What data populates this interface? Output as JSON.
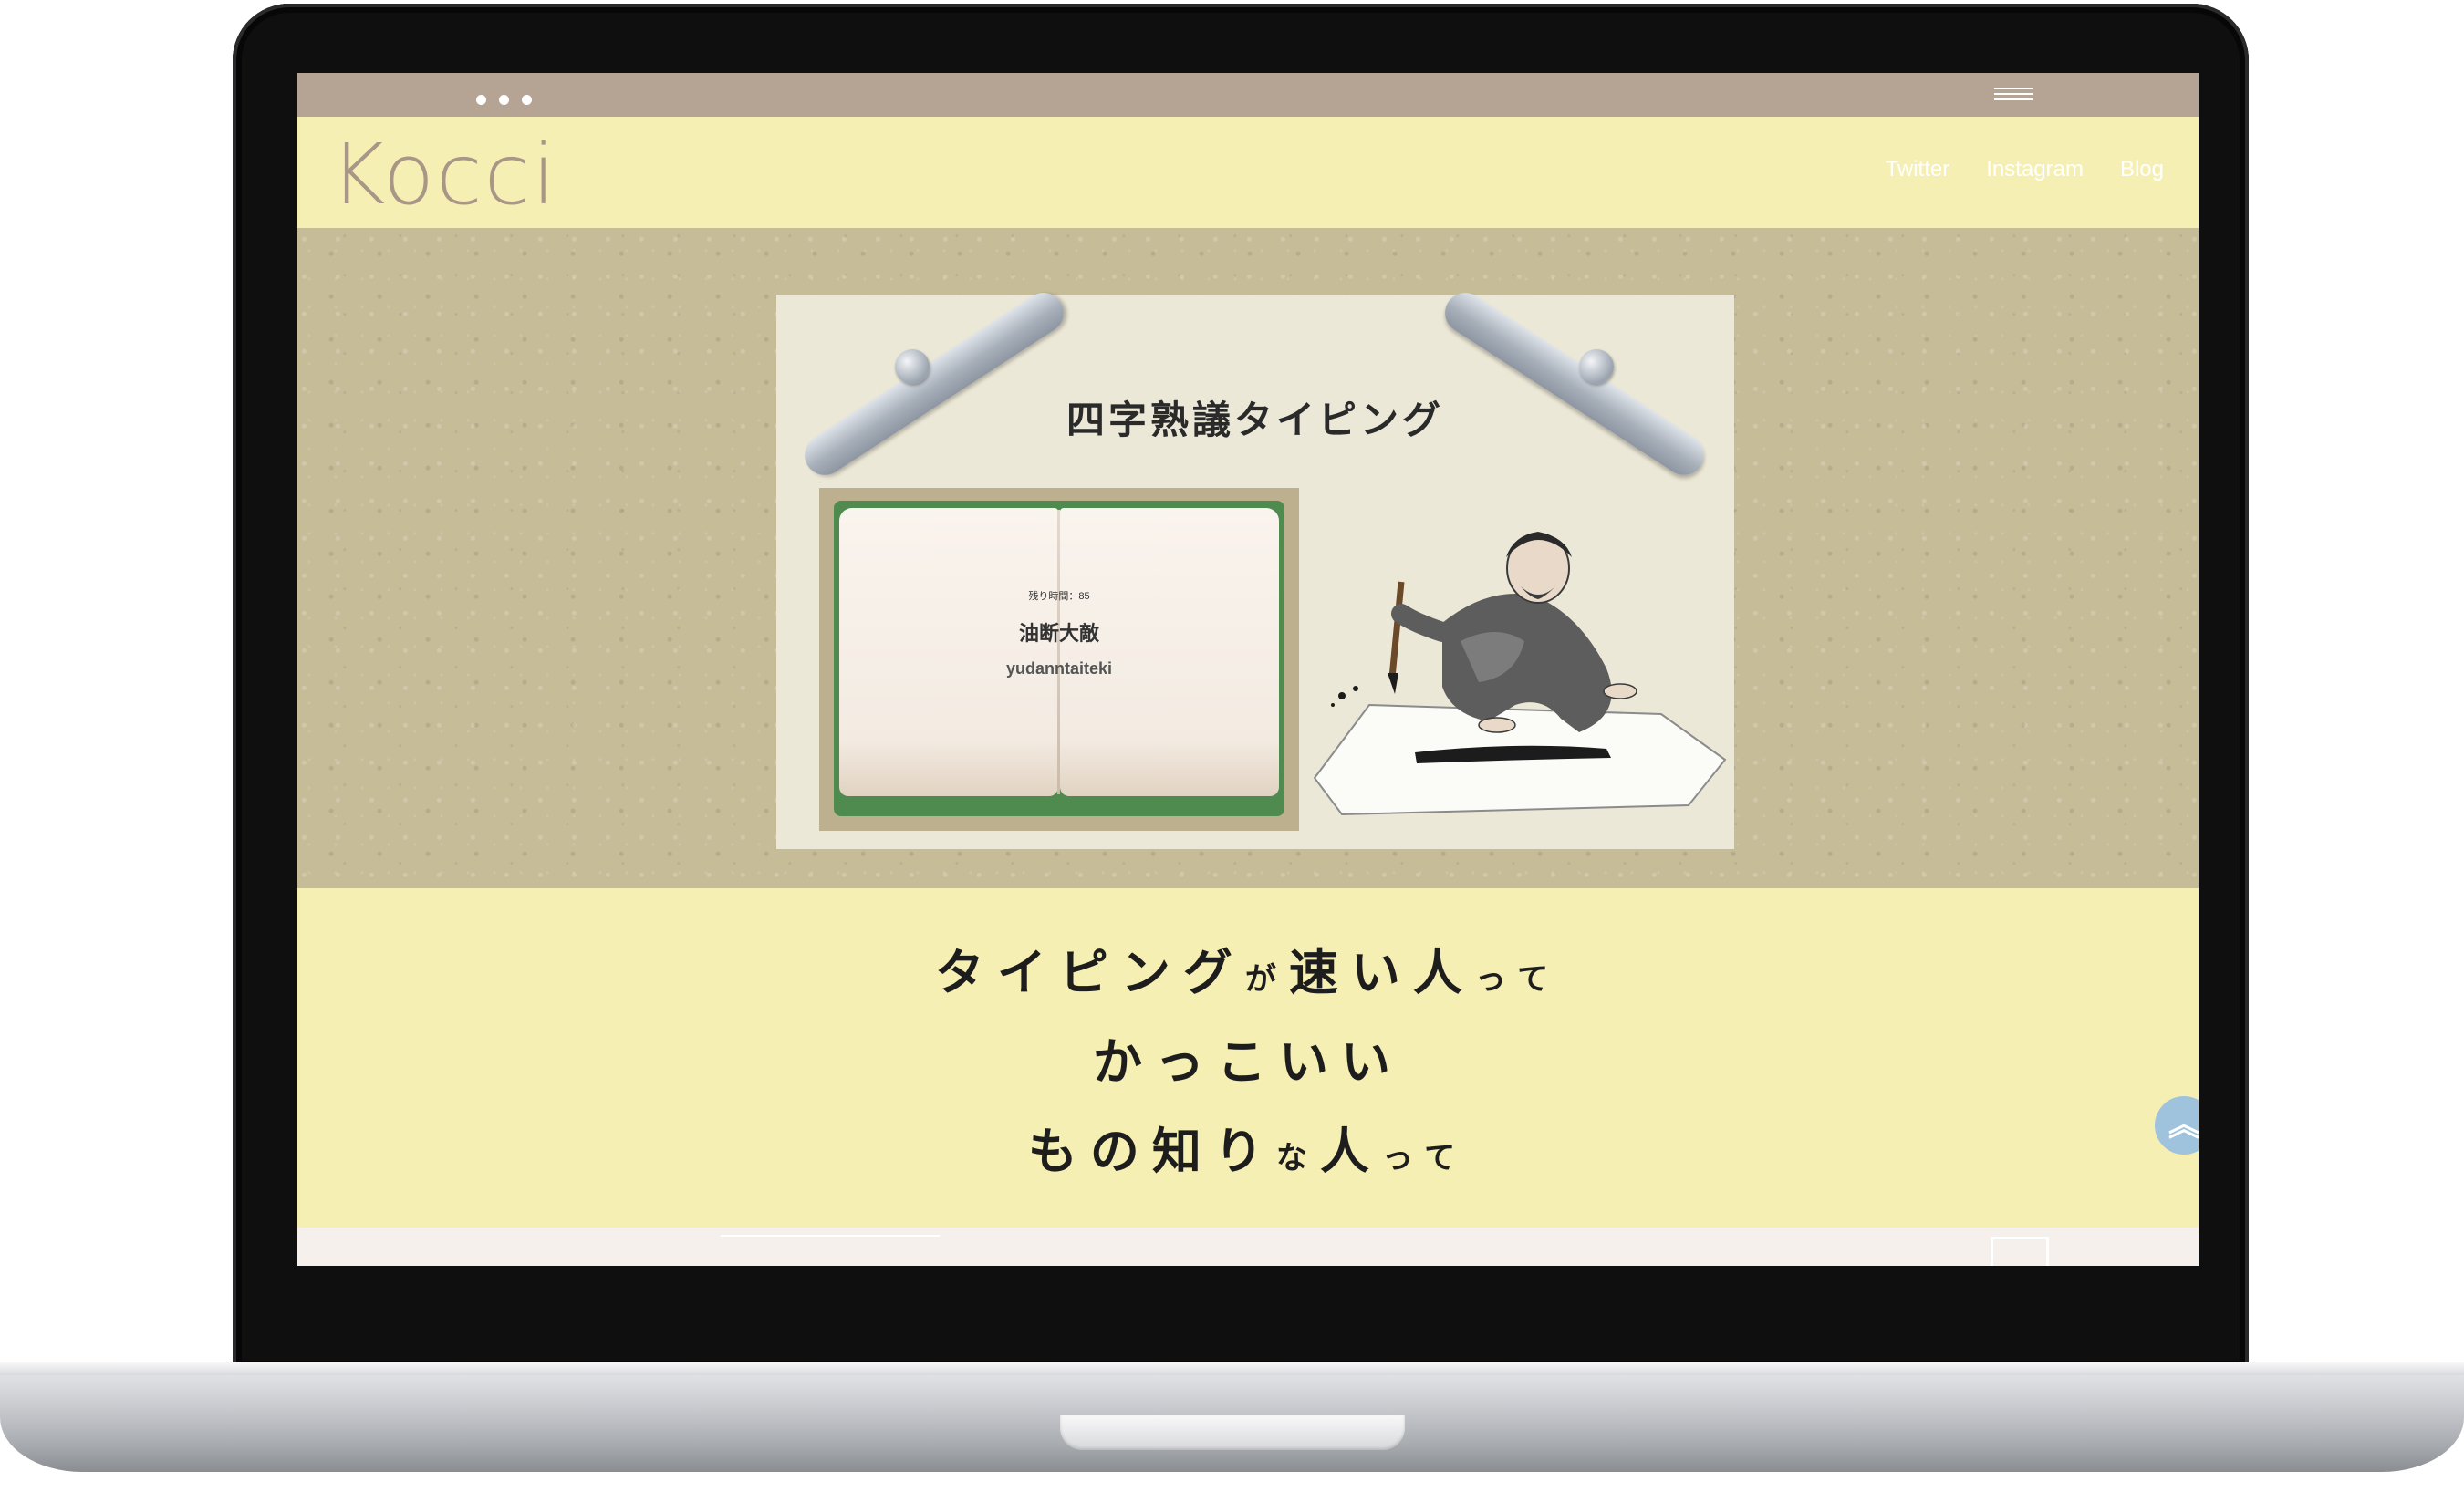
{
  "browser": {
    "menu_icon": "hamburger-icon"
  },
  "header": {
    "logo": "Kocci",
    "nav": [
      "Twitter",
      "Instagram",
      "Blog"
    ]
  },
  "game": {
    "title": "四字熟議タイピング",
    "time_left": "残り時間：85",
    "word": "油断大敵",
    "romaji": "yudanntaiteki"
  },
  "tagline": {
    "line1_a": "タイピング",
    "line1_b": "が",
    "line1_c": "速い人",
    "line1_d": "って",
    "line2": "かっこいい",
    "line3_a": "もの知り",
    "line3_b": "な",
    "line3_c": "人",
    "line3_d": "って"
  },
  "scroll_top": {
    "icon": "double-chevron-up-icon",
    "glyph": "︽"
  },
  "footer": {
    "icon": "mail-icon"
  },
  "colors": {
    "browser_bar": "#b5a393",
    "header_bg": "#f6efb4",
    "logo": "#a89686",
    "hero_bg": "#c7bc98",
    "scroll_button": "#9fc3dc"
  }
}
